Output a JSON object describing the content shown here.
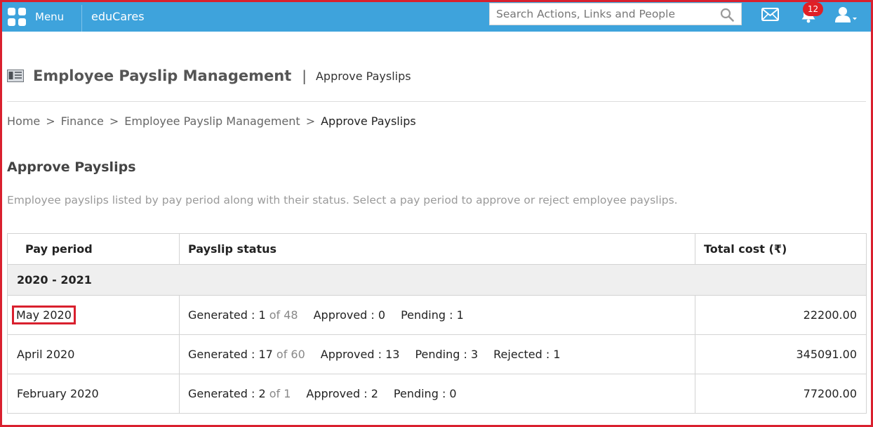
{
  "topbar": {
    "menu_label": "Menu",
    "brand": "eduCares",
    "search_placeholder": "Search Actions, Links and People",
    "notification_count": "12"
  },
  "page": {
    "title": "Employee Payslip Management",
    "separator": "|",
    "subtitle": "Approve Payslips"
  },
  "breadcrumb": {
    "items": [
      "Home",
      "Finance",
      "Employee Payslip Management",
      "Approve Payslips"
    ],
    "separator": ">"
  },
  "section": {
    "title": "Approve Payslips",
    "description": "Employee payslips listed by pay period along with their status. Select a pay period to approve or reject employee payslips."
  },
  "table": {
    "headers": [
      "Pay period",
      "Payslip status",
      "Total cost (₹)"
    ],
    "group": "2020 - 2021",
    "rows": [
      {
        "period": "May 2020",
        "generated": "Generated : 1",
        "generated_of": "of 48",
        "approved": "Approved : 0",
        "pending": "Pending : 1",
        "cost": "22200.00"
      },
      {
        "period": "April 2020",
        "generated": "Generated : 17",
        "generated_of": "of 60",
        "approved": "Approved : 13",
        "pending": "Pending : 3",
        "rejected": "Rejected : 1",
        "cost": "345091.00"
      },
      {
        "period": "February 2020",
        "generated": "Generated : 2",
        "generated_of": "of 1",
        "approved": "Approved : 2",
        "pending": "Pending : 0",
        "cost": "77200.00"
      }
    ]
  },
  "colors": {
    "topbar": "#3ea3dc",
    "frame": "#d9202e",
    "badge": "#e02026",
    "group_row": "#efefef"
  },
  "icons": [
    "menu-grid-icon",
    "search-icon",
    "mail-icon",
    "bell-icon",
    "user-icon",
    "payslip-icon"
  ]
}
